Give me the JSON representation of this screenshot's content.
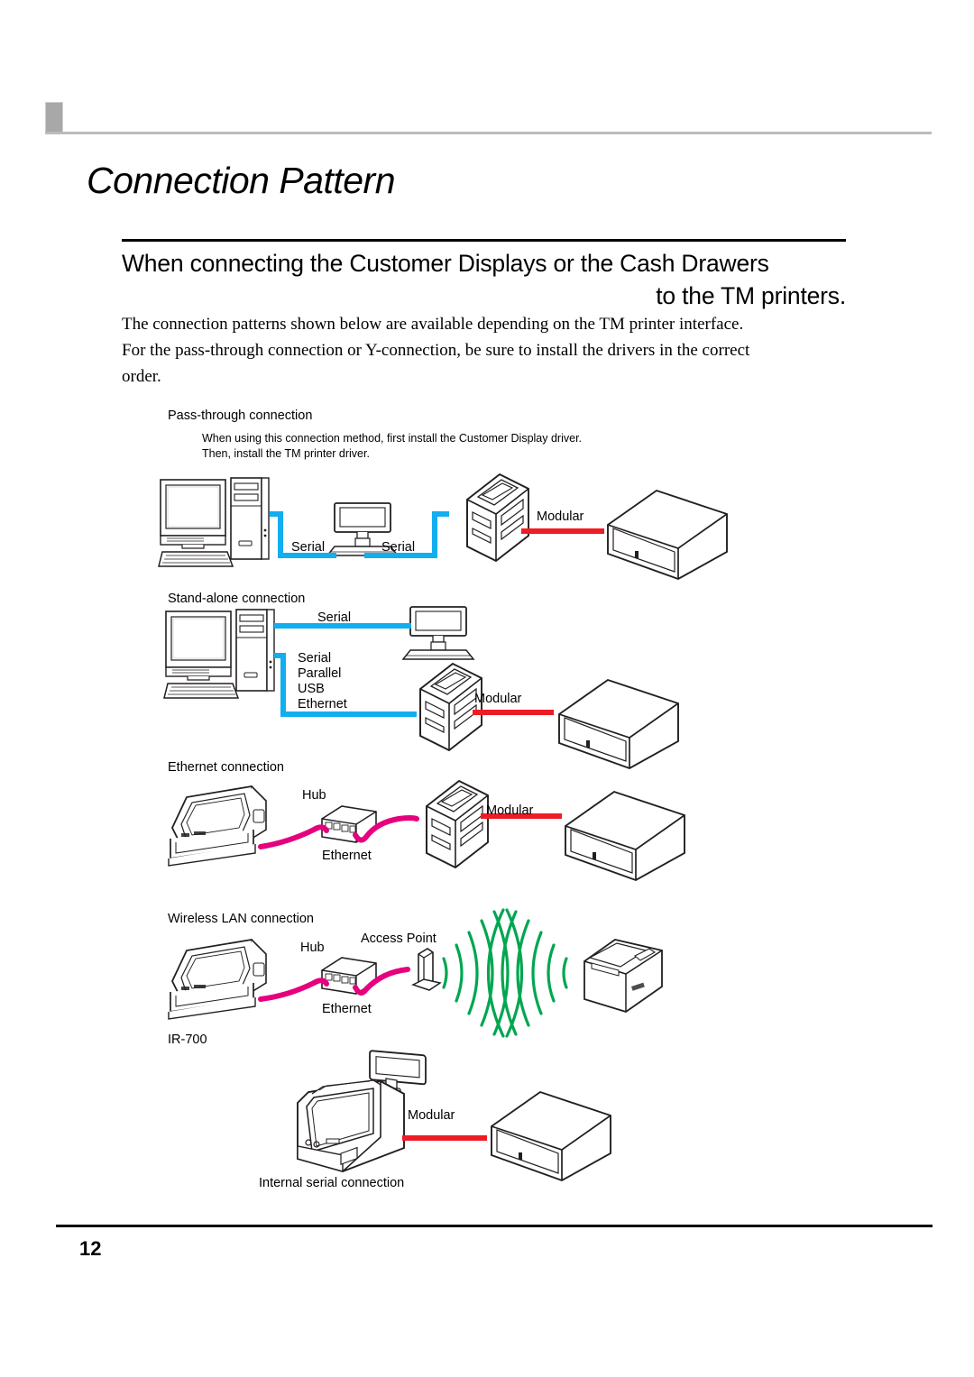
{
  "document": {
    "chapter_title": "Connection Pattern",
    "section_heading_line1": "When connecting the Customer Displays or the Cash Drawers",
    "section_heading_line2": "to the TM printers.",
    "intro_line1": "The connection patterns shown below are available depending on the TM printer interface.",
    "intro_line2": "For the pass-through connection or Y-connection, be sure to install the drivers in the correct",
    "intro_line3": "order.",
    "page_number": "12"
  },
  "colors": {
    "serial_cable": "#12AEEF",
    "modular_cable": "#EE1C25",
    "ethernet_cable": "#E6007E",
    "wireless_wave": "#00A650",
    "outline": "#231F20",
    "header_bar": "#a8a8a8",
    "header_rule": "#bcbcbc"
  },
  "diagrams": [
    {
      "id": "pass-through",
      "title": "Pass-through connection",
      "notes": [
        "When using this connection method, first install the Customer Display driver.",
        "Then, install the TM printer driver."
      ],
      "cable_labels": [
        "Serial",
        "Serial",
        "Modular"
      ],
      "devices": [
        "desktop-pc",
        "customer-display",
        "tm-printer",
        "cash-drawer"
      ]
    },
    {
      "id": "stand-alone",
      "title": "Stand-alone connection",
      "notes": [],
      "cable_labels": [
        "Serial",
        "Serial",
        "Parallel",
        "USB",
        "Ethernet",
        "Modular"
      ],
      "interface_list": [
        "Serial",
        "Parallel",
        "USB",
        "Ethernet"
      ],
      "devices": [
        "desktop-pc",
        "customer-display",
        "tm-printer",
        "cash-drawer"
      ]
    },
    {
      "id": "ethernet",
      "title": "Ethernet connection",
      "notes": [],
      "cable_labels": [
        "Ethernet",
        "Modular"
      ],
      "device_labels": [
        "Hub"
      ],
      "devices": [
        "pos-terminal",
        "hub",
        "tm-printer",
        "cash-drawer"
      ]
    },
    {
      "id": "wireless-lan",
      "title": "Wireless LAN connection",
      "notes": [],
      "cable_labels": [
        "Ethernet"
      ],
      "device_labels": [
        "Hub",
        "Access Point"
      ],
      "devices": [
        "pos-terminal",
        "hub",
        "access-point",
        "wireless-tm-printer"
      ]
    },
    {
      "id": "ir700",
      "title": "IR-700",
      "caption": "Internal serial connection",
      "cable_labels": [
        "Modular"
      ],
      "devices": [
        "ir700-pos-terminal",
        "cash-drawer"
      ]
    }
  ]
}
